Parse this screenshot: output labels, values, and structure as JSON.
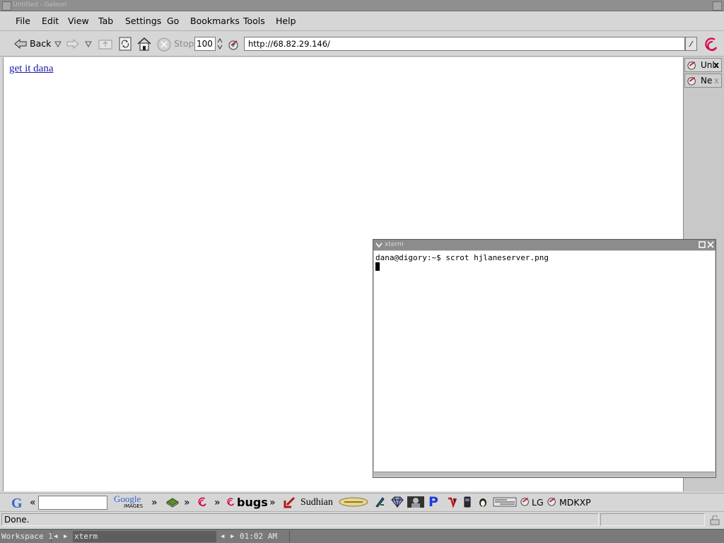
{
  "window": {
    "title": "Untitled - Galeon"
  },
  "menubar": {
    "items": [
      {
        "label": "File"
      },
      {
        "label": "Edit"
      },
      {
        "label": "View"
      },
      {
        "label": "Tab"
      },
      {
        "label": "Settings"
      },
      {
        "label": "Go"
      },
      {
        "label": "Bookmarks"
      },
      {
        "label": "Tools"
      },
      {
        "label": "Help"
      }
    ]
  },
  "toolbar": {
    "back_label": "Back",
    "stop_label": "Stop",
    "zoom_value": "100",
    "url_value": "http://68.82.29.146/"
  },
  "page": {
    "link_text": "get it dana",
    "link_color": "#1a1aa6"
  },
  "tabs": [
    {
      "label": "Unl",
      "close": "x"
    },
    {
      "label": "Ne",
      "close": "x"
    }
  ],
  "bookmarks": {
    "search_arrow": "«",
    "raquo": "»",
    "google_images_top": "Google",
    "google_images_bottom": "IMAGES",
    "bugs_label": "bugs",
    "sudhian_label": "Sudhian",
    "lg_label": "LG",
    "mdkxp_label": "MDKXP"
  },
  "status": {
    "text": "Done."
  },
  "taskbar": {
    "workspace": "Workspace 1",
    "task": "xterm",
    "clock": "01:02 AM"
  },
  "xterm": {
    "title": "xterm",
    "prompt_line": "dana@digory:~$ scrot hjlaneserver.png"
  },
  "colors": {
    "debian_red": "#d70751",
    "google_blue": "#3366cc"
  }
}
